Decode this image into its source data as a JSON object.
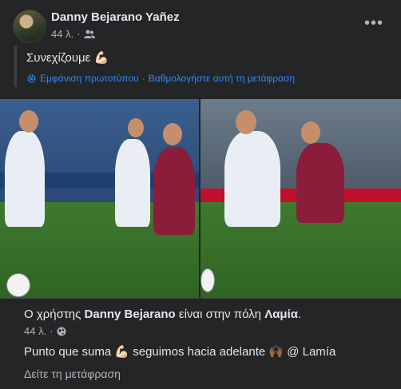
{
  "post": {
    "author": "Danny Bejarano Yañez",
    "time": "44 λ.",
    "audience_icon": "friends-icon",
    "more_label": "•••"
  },
  "shared": {
    "text": "Συνεχίζουμε 💪🏻",
    "show_original": "Εμφάνιση πρωτοτύπου",
    "separator": "·",
    "rate_translation": "Βαθμολογήστε αυτή τη μετάφραση"
  },
  "checkin": {
    "prefix": "Ο χρήστης",
    "name": "Danny Bejarano",
    "middle": "είναι στην πόλη",
    "place": "Λαμία",
    "suffix": ".",
    "time": "44 λ.",
    "audience_icon": "globe-icon",
    "text": "Punto que suma 💪🏻 seguimos hacia adelante 🙌🏾 @ Lamía",
    "see_translation": "Δείτε τη μετάφραση"
  },
  "colors": {
    "background": "#242526",
    "link": "#2d88ff",
    "secondary_text": "#b0b3b8"
  }
}
